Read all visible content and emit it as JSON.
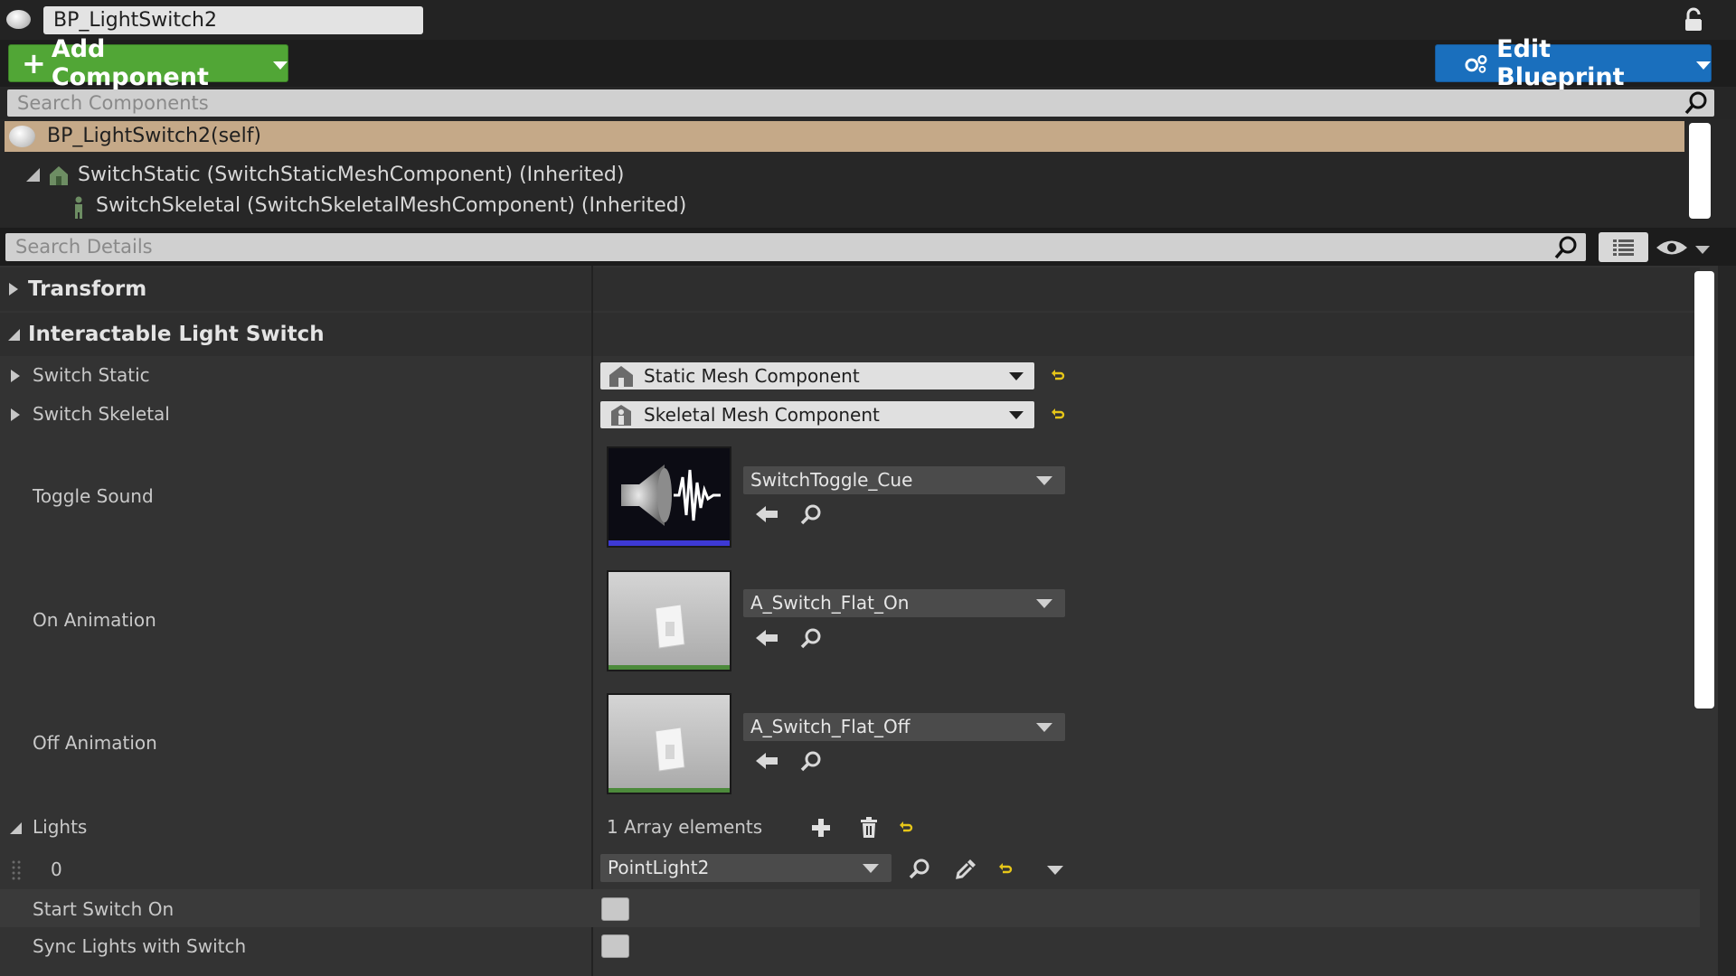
{
  "title_bar": {
    "blueprint_name": "BP_LightSwitch2"
  },
  "toolbar": {
    "add_component_label": "Add Component",
    "edit_blueprint_label": "Edit Blueprint"
  },
  "components": {
    "search_placeholder": "Search Components",
    "self_label": "BP_LightSwitch2(self)",
    "items": [
      {
        "label": "SwitchStatic (SwitchStaticMeshComponent) (Inherited)"
      },
      {
        "label": "SwitchSkeletal (SwitchSkeletalMeshComponent) (Inherited)"
      }
    ]
  },
  "details": {
    "search_placeholder": "Search Details",
    "categories": {
      "transform": "Transform",
      "interactable": "Interactable Light Switch"
    },
    "props": {
      "switch_static": {
        "label": "Switch Static",
        "value": "Static Mesh Component"
      },
      "switch_skeletal": {
        "label": "Switch Skeletal",
        "value": "Skeletal Mesh Component"
      },
      "toggle_sound": {
        "label": "Toggle Sound",
        "value": "SwitchToggle_Cue"
      },
      "on_animation": {
        "label": "On Animation",
        "value": "A_Switch_Flat_On"
      },
      "off_animation": {
        "label": "Off Animation",
        "value": "A_Switch_Flat_Off"
      },
      "lights": {
        "label": "Lights",
        "array_text": "1 Array elements",
        "index": "0",
        "value": "PointLight2"
      },
      "start_switch_on": {
        "label": "Start Switch On",
        "checked": false
      },
      "sync_lights": {
        "label": "Sync Lights with Switch",
        "checked": false
      }
    }
  },
  "icons": {
    "lock": "unlock-icon",
    "search": "search-icon",
    "eye": "eye-icon",
    "list": "list-view-icon",
    "reset": "reset-to-default-icon",
    "browse": "browse-asset-icon",
    "use": "use-selected-arrow-icon",
    "add": "add-element-icon",
    "trash": "trash-icon",
    "pick": "eyedropper-icon"
  },
  "colors": {
    "add_button": "#51a636",
    "edit_button": "#1a6fbd",
    "selected_row": "#c5a988",
    "reset_arrow": "#e6c619"
  }
}
